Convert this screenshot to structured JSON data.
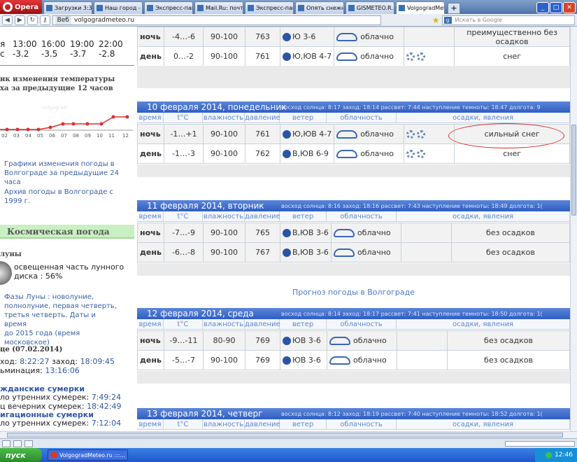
{
  "browser": {
    "opera_label": "Opera",
    "tabs": [
      {
        "label": "Загрузки 3:36"
      },
      {
        "label": "Наш город - ..."
      },
      {
        "label": "Экспресс-пан..."
      },
      {
        "label": "Mail.Ru: почт..."
      },
      {
        "label": "Экспресс-пан..."
      },
      {
        "label": "Опять снежн..."
      },
      {
        "label": "GISMETEO.R..."
      },
      {
        "label": "VolgogradMet..."
      }
    ],
    "web_label": "Веб",
    "url": "volgogradmeteo.ru",
    "search_placeholder": "Искать в Google"
  },
  "sidebar": {
    "mini_times": {
      "label": "я",
      "values": [
        "13:00",
        "16:00",
        "19:00",
        "22:00"
      ]
    },
    "mini_temps": {
      "label": "c",
      "values": [
        "-3.2",
        "-3.5",
        "-3.7",
        "-2.8"
      ]
    },
    "chart_heading_1": "ик изменения температуры",
    "chart_heading_2": "ха за предыдущие 12 часов",
    "chart_watermark": "volgograd",
    "chart_ticks": [
      "02",
      "03",
      "04",
      "05",
      "06",
      "07",
      "08",
      "09",
      "10",
      "11",
      "12"
    ],
    "link_charts_1": "Графики изменения погоды в",
    "link_charts_2": "Волгограде за предыдущие 24",
    "link_charts_3": "часа",
    "link_archive_1": "Архив погоды в Волгограде с",
    "link_archive_2": "1999 г.",
    "cosmic_title": "Космическая погода",
    "moon_heading": "луны",
    "moon_text_1": "освещенная часть лунного",
    "moon_text_2": "диска : 56%",
    "phases_1": "Фазы Луны : новолуние,",
    "phases_2": "полнолуние, первая четверть,",
    "phases_3": "третья четверть. Даты и время",
    "phases_4": "до 2015 года (время",
    "phases_5": "московское)",
    "sun_heading": "це (07.02.2014)",
    "sunrise_label": "ход:",
    "sunrise_val": "8:22:27",
    "sunset_label": "заход:",
    "sunset_val": "18:09:45",
    "daylen_label": "ьминация:",
    "daylen_val": "13:16:06",
    "civil_heading": "жданские сумерки",
    "civil_start_label": "ло утренних сумерек:",
    "civil_start_val": "7:49:24",
    "civil_end_label": "ц вечерних сумерек:",
    "civil_end_val": "18:42:49",
    "naut_heading": "игационные сумерки",
    "naut_start_label": "ло утренних сумерек:",
    "naut_start_val": "7:12:04"
  },
  "columns": [
    "время",
    "t°C",
    "влажность",
    "давление",
    "ветер",
    "облачность",
    "осадки, явления"
  ],
  "day0": {
    "rows": [
      {
        "tod": "ночь",
        "temp": "-4…-6",
        "hum": "90-100",
        "pr": "763",
        "wdir": "Ю",
        "wspd": "3-6",
        "cloud": "облачно",
        "prec": "преимущественно без осадков"
      },
      {
        "tod": "день",
        "temp": "0…-2",
        "hum": "90-100",
        "pr": "761",
        "wdir": "Ю,ЮВ",
        "wspd": "4-7",
        "cloud": "облачно",
        "prec": "снег"
      }
    ]
  },
  "day1": {
    "date": "10 февраля 2014, понедельник",
    "astro": "восход солнца: 8:17   заход: 18:14   рассвет: 7:44   наступление темноты: 18:47   долгота: 9",
    "rows": [
      {
        "tod": "ночь",
        "temp": "-1…+1",
        "hum": "90-100",
        "pr": "761",
        "wdir": "Ю,ЮВ",
        "wspd": "4-7",
        "cloud": "облачно",
        "prec": "сильный снег"
      },
      {
        "tod": "день",
        "temp": "-1…-3",
        "hum": "90-100",
        "pr": "762",
        "wdir": "В,ЮВ",
        "wspd": "6-9",
        "cloud": "облачно",
        "prec": "снег"
      }
    ]
  },
  "day2": {
    "date": "11 февраля 2014, вторник",
    "astro": "восход солнца: 8:16   заход: 18:16   рассвет: 7:43   наступление темноты: 18:49   долгота: 1(",
    "rows": [
      {
        "tod": "ночь",
        "temp": "-7…-9",
        "hum": "90-100",
        "pr": "765",
        "wdir": "В,ЮВ",
        "wspd": "3-6",
        "cloud": "облачно",
        "prec": "без осадков"
      },
      {
        "tod": "день",
        "temp": "-6…-8",
        "hum": "90-100",
        "pr": "767",
        "wdir": "В,ЮВ",
        "wspd": "3-6",
        "cloud": "облачно",
        "prec": "без осадков"
      }
    ]
  },
  "forecast_link": "Прогноз погоды в Волгограде",
  "day3": {
    "date": "12 февраля 2014, среда",
    "astro": "восход солнца: 8:14   заход: 18:17   рассвет: 7:41   наступление темноты: 18:50   долгота: 1(",
    "rows": [
      {
        "tod": "ночь",
        "temp": "-9…-11",
        "hum": "80-90",
        "pr": "769",
        "wdir": "ЮВ",
        "wspd": "3-6",
        "cloud": "облачно",
        "prec": "без осадков"
      },
      {
        "tod": "день",
        "temp": "-5…-7",
        "hum": "90-100",
        "pr": "769",
        "wdir": "ЮВ",
        "wspd": "3-6",
        "cloud": "облачно",
        "prec": "без осадков"
      }
    ]
  },
  "day4": {
    "date": "13 февраля 2014, четверг",
    "astro": "восход солнца: 8:12   заход: 18:19   рассвет: 7:40   наступление темноты: 18:52   долгота: 1("
  },
  "taskbar": {
    "start": "пуск",
    "task": "VolgogradMeteo.ru :::...",
    "clock": "12:46"
  }
}
